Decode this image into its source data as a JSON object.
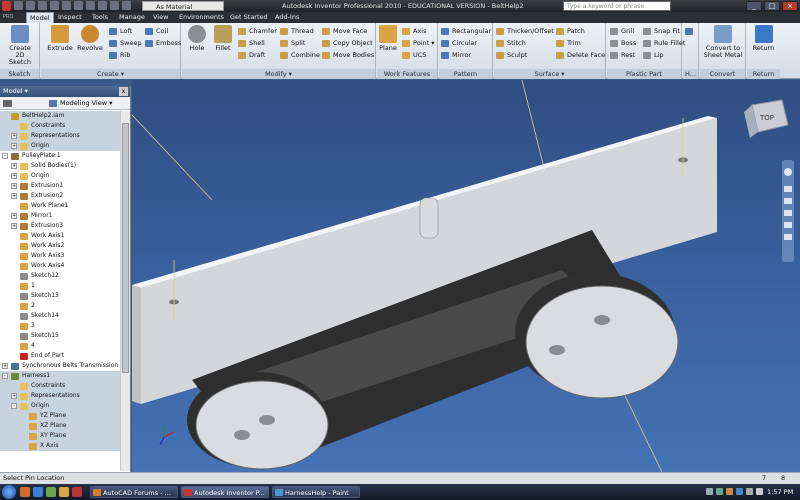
{
  "titlebar": {
    "material": "As Material",
    "title": "Autodesk Inventor Professional 2010 - EDUCATIONAL VERSION - BeltHelp2",
    "search_placeholder": "Type a keyword or phrase",
    "minimize": "_",
    "restore": "□",
    "close": "×"
  },
  "menu": {
    "pro": "PRO",
    "tabs": [
      "Model",
      "Inspect",
      "Tools",
      "Manage",
      "View",
      "Environments",
      "Get Started",
      "Add-Ins"
    ]
  },
  "ribbon": {
    "sketch": {
      "create_line1": "Create",
      "create_line2": "2D Sketch",
      "label": "Sketch"
    },
    "create": {
      "extrude": "Extrude",
      "revolve": "Revolve",
      "loft": "Loft",
      "sweep": "Sweep",
      "rib": "Rib",
      "coil": "Coil",
      "emboss": "Emboss",
      "label": "Create ▾"
    },
    "modify": {
      "hole": "Hole",
      "fillet": "Fillet",
      "chamfer": "Chamfer",
      "shell": "Shell",
      "draft": "Draft",
      "thread": "Thread",
      "split": "Split",
      "combine": "Combine",
      "move_face": "Move Face",
      "copy_object": "Copy Object",
      "move_bodies": "Move Bodies",
      "label": "Modify ▾"
    },
    "work_features": {
      "plane": "Plane",
      "axis": "Axis",
      "point": "Point ▾",
      "ucs": "UCS",
      "label": "Work Features"
    },
    "pattern": {
      "rectangular": "Rectangular",
      "circular": "Circular",
      "mirror": "Mirror",
      "label": "Pattern"
    },
    "surface": {
      "thicken": "Thicken/Offset",
      "stitch": "Stitch",
      "sculpt": "Sculpt",
      "patch": "Patch",
      "trim": "Trim",
      "delete_face": "Delete Face",
      "label": "Surface ▾"
    },
    "plastic": {
      "grill": "Grill",
      "boss": "Boss",
      "rest": "Rest",
      "snap_fit": "Snap Fit",
      "rule_fillet": "Rule Fillet",
      "lip": "Lip",
      "label": "Plastic Part"
    },
    "harness": {
      "label": "H..."
    },
    "convert": {
      "line1": "Convert to",
      "line2": "Sheet Metal",
      "label": "Convert"
    },
    "return": {
      "text": "Return",
      "label": "Return"
    }
  },
  "browser": {
    "header": "Model ▾",
    "close": "x",
    "view": "Modeling View ▾",
    "rows": [
      {
        "label": "BeltHelp2.iam",
        "indent": 0,
        "exp": "",
        "icon": "#c89a2a",
        "sel": true
      },
      {
        "label": "Constraints",
        "indent": 1,
        "exp": "",
        "icon": "#e5c05a",
        "sel": true
      },
      {
        "label": "Representations",
        "indent": 1,
        "exp": "+",
        "icon": "#e5c05a",
        "sel": true
      },
      {
        "label": "Origin",
        "indent": 1,
        "exp": "+",
        "icon": "#e5c05a",
        "sel": true
      },
      {
        "label": "PulleyPlate:1",
        "indent": 0,
        "exp": "-",
        "icon": "#8a6d3b",
        "sel": false
      },
      {
        "label": "Solid Bodies(1)",
        "indent": 1,
        "exp": "+",
        "icon": "#e5c05a",
        "sel": false
      },
      {
        "label": "Origin",
        "indent": 1,
        "exp": "+",
        "icon": "#e5c05a",
        "sel": false
      },
      {
        "label": "Extrusion1",
        "indent": 1,
        "exp": "+",
        "icon": "#b07b3a",
        "sel": false
      },
      {
        "label": "Extrusion2",
        "indent": 1,
        "exp": "+",
        "icon": "#b07b3a",
        "sel": false
      },
      {
        "label": "Work Plane1",
        "indent": 1,
        "exp": "",
        "icon": "#d9a441",
        "sel": false
      },
      {
        "label": "Mirror1",
        "indent": 1,
        "exp": "+",
        "icon": "#b07b3a",
        "sel": false
      },
      {
        "label": "Extrusion3",
        "indent": 1,
        "exp": "+",
        "icon": "#b07b3a",
        "sel": false
      },
      {
        "label": "Work Axis1",
        "indent": 1,
        "exp": "",
        "icon": "#d9a441",
        "sel": false
      },
      {
        "label": "Work Axis2",
        "indent": 1,
        "exp": "",
        "icon": "#d9a441",
        "sel": false
      },
      {
        "label": "Work Axis3",
        "indent": 1,
        "exp": "",
        "icon": "#d9a441",
        "sel": false
      },
      {
        "label": "Work Axis4",
        "indent": 1,
        "exp": "",
        "icon": "#d9a441",
        "sel": false
      },
      {
        "label": "Sketch12",
        "indent": 1,
        "exp": "",
        "icon": "#8a8a8a",
        "sel": false
      },
      {
        "label": "1",
        "indent": 1,
        "exp": "",
        "icon": "#d9a441",
        "sel": false
      },
      {
        "label": "Sketch13",
        "indent": 1,
        "exp": "",
        "icon": "#8a8a8a",
        "sel": false
      },
      {
        "label": "2",
        "indent": 1,
        "exp": "",
        "icon": "#d9a441",
        "sel": false
      },
      {
        "label": "Sketch14",
        "indent": 1,
        "exp": "",
        "icon": "#8a8a8a",
        "sel": false
      },
      {
        "label": "3",
        "indent": 1,
        "exp": "",
        "icon": "#d9a441",
        "sel": false
      },
      {
        "label": "Sketch15",
        "indent": 1,
        "exp": "",
        "icon": "#8a8a8a",
        "sel": false
      },
      {
        "label": "4",
        "indent": 1,
        "exp": "",
        "icon": "#d9a441",
        "sel": false
      },
      {
        "label": "End of Part",
        "indent": 1,
        "exp": "",
        "icon": "#cc2222",
        "sel": false
      },
      {
        "label": "Synchronous Belts Transmission",
        "indent": 0,
        "exp": "+",
        "icon": "#4a6ea8",
        "sel": false
      },
      {
        "label": "Harness1",
        "indent": 0,
        "exp": "-",
        "icon": "#6a8a3a",
        "sel": true
      },
      {
        "label": "Constraints",
        "indent": 1,
        "exp": "",
        "icon": "#e5c05a",
        "sel": true
      },
      {
        "label": "Representations",
        "indent": 1,
        "exp": "+",
        "icon": "#e5c05a",
        "sel": true
      },
      {
        "label": "Origin",
        "indent": 1,
        "exp": "-",
        "icon": "#e5c05a",
        "sel": true
      },
      {
        "label": "YZ Plane",
        "indent": 2,
        "exp": "",
        "icon": "#d9a441",
        "sel": true
      },
      {
        "label": "XZ Plane",
        "indent": 2,
        "exp": "",
        "icon": "#d9a441",
        "sel": true
      },
      {
        "label": "XY Plane",
        "indent": 2,
        "exp": "",
        "icon": "#d9a441",
        "sel": true
      },
      {
        "label": "X Axis",
        "indent": 2,
        "exp": "",
        "icon": "#d9a441",
        "sel": true
      }
    ]
  },
  "viewcube": {
    "face": "TOP"
  },
  "status": {
    "message": "Select Pin Location",
    "count1": "7",
    "count2": "8"
  },
  "taskbar": {
    "tasks": [
      "AutoCAD Forums - ...",
      "Autodesk Inventor P...",
      "HarnessHelp - Paint"
    ],
    "clock": "1:57 PM"
  }
}
